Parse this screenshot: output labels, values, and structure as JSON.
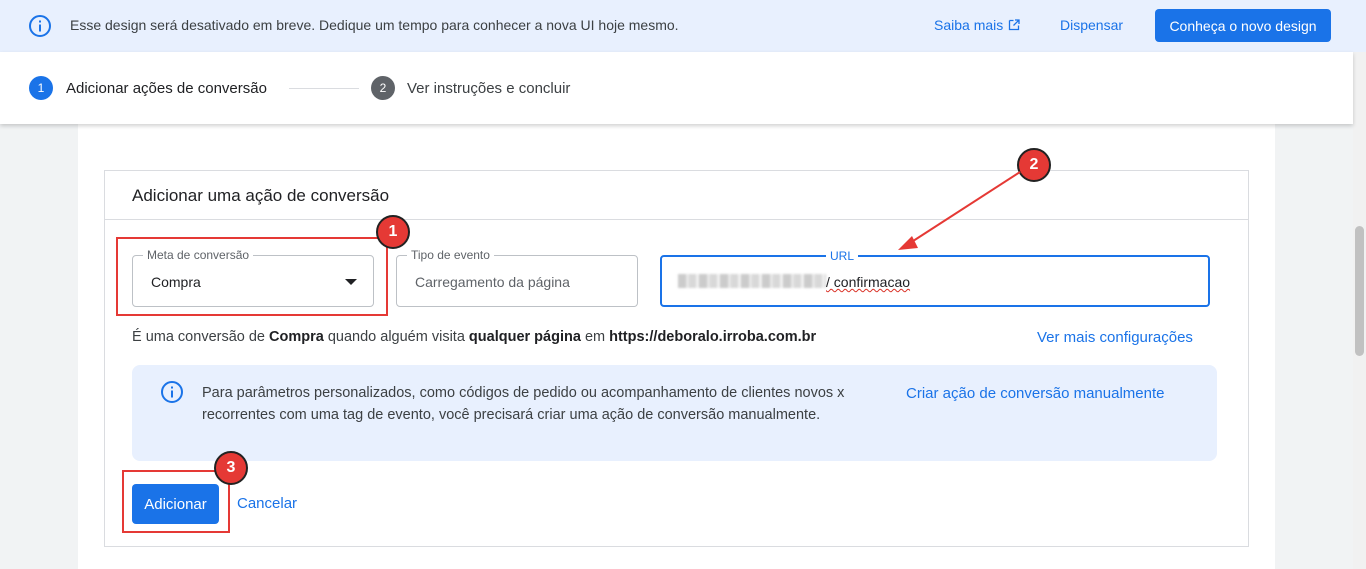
{
  "banner": {
    "message": "Esse design será desativado em breve. Dedique um tempo para conhecer a nova UI hoje mesmo.",
    "saiba_mais": "Saiba mais",
    "dispensar": "Dispensar",
    "novo_design": "Conheça o novo design"
  },
  "stepper": {
    "steps": [
      {
        "number": "1",
        "label": "Adicionar ações de conversão",
        "state": "active"
      },
      {
        "number": "2",
        "label": "Ver instruções e concluir",
        "state": "inactive"
      }
    ]
  },
  "form": {
    "title": "Adicionar uma ação de conversão",
    "meta": {
      "label": "Meta de conversão",
      "value": "Compra"
    },
    "tipo": {
      "label": "Tipo de evento",
      "value": "Carregamento da página"
    },
    "url": {
      "label": "URL",
      "value": "/ confirmacao"
    },
    "description": {
      "p1": "É uma conversão de ",
      "b1": "Compra",
      "p2": " quando alguém visita ",
      "b2": "qualquer página",
      "p3": " em ",
      "b3": "https://deboralo.irroba.com.br"
    },
    "ver_mais": "Ver mais configurações",
    "info_text": "Para parâmetros personalizados, como códigos de pedido ou acompanhamento de clientes novos x recorrentes com uma tag de evento, você precisará criar uma ação de conversão manualmente.",
    "criar_manual": "Criar ação de conversão manualmente",
    "adicionar": "Adicionar",
    "cancelar": "Cancelar"
  },
  "annotations": {
    "badge1": "1",
    "badge2": "2",
    "badge3": "3"
  },
  "colors": {
    "primary": "#1a73e8",
    "annotation": "#e53935",
    "banner_bg": "#e8f0fe"
  }
}
